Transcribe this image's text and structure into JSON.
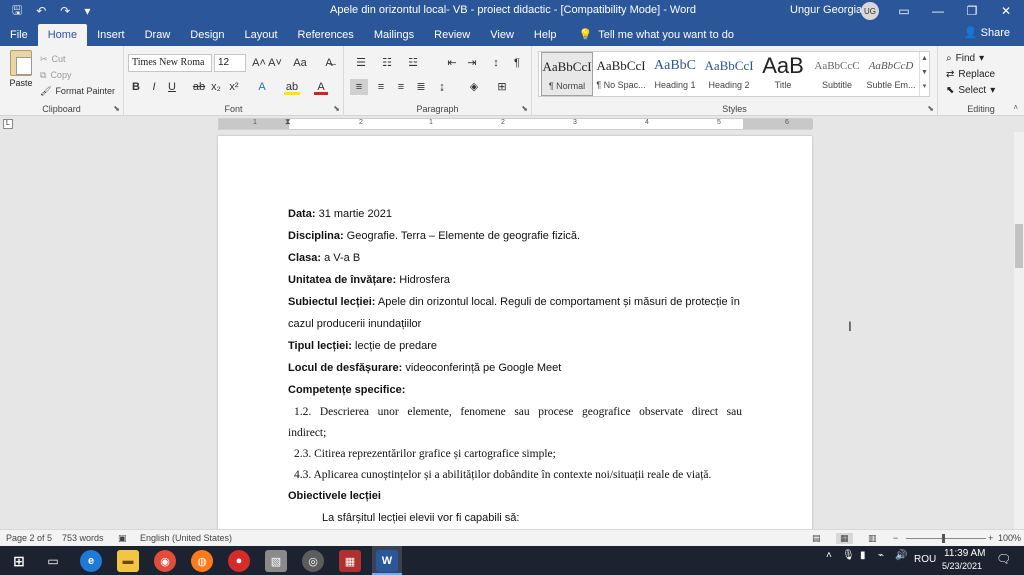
{
  "window": {
    "title": "Apele din orizontul local- VB - proiect didactic - [Compatibility Mode] - Word",
    "user": "Ungur Georgian",
    "user_initials": "UG"
  },
  "tabs": [
    "File",
    "Home",
    "Insert",
    "Draw",
    "Design",
    "Layout",
    "References",
    "Mailings",
    "Review",
    "View",
    "Help"
  ],
  "active_tab": "Home",
  "tell_me": "Tell me what you want to do",
  "share": "Share",
  "clipboard": {
    "paste": "Paste",
    "cut": "Cut",
    "copy": "Copy",
    "format_painter": "Format Painter",
    "label": "Clipboard"
  },
  "font": {
    "name": "Times New Roma",
    "size": "12",
    "label": "Font"
  },
  "paragraph": {
    "label": "Paragraph"
  },
  "styles": {
    "label": "Styles",
    "items": [
      {
        "preview": "AaBbCcI",
        "name": "¶ Normal"
      },
      {
        "preview": "AaBbCcI",
        "name": "¶ No Spac..."
      },
      {
        "preview": "AaBbC",
        "name": "Heading 1"
      },
      {
        "preview": "AaBbCcI",
        "name": "Heading 2"
      },
      {
        "preview": "AaB",
        "name": "Title"
      },
      {
        "preview": "AaBbCcC",
        "name": "Subtitle"
      },
      {
        "preview": "AaBbCcD",
        "name": "Subtle Em..."
      }
    ]
  },
  "editing": {
    "find": "Find",
    "replace": "Replace",
    "select": "Select",
    "label": "Editing"
  },
  "ruler_numbers": [
    "1",
    "2",
    "1",
    "2",
    "3",
    "4",
    "5",
    "6",
    "7"
  ],
  "document": {
    "lines": [
      {
        "label": "Data:",
        "text": " 31 martie 2021"
      },
      {
        "label": "Disciplina:",
        "text": " Geografie. Terra – Elemente de geografie fizică."
      },
      {
        "label": "Clasa:",
        "text": " a V-a B"
      },
      {
        "label": "Unitatea de învățare:",
        "text": " Hidrosfera"
      },
      {
        "label": "Subiectul lecției:",
        "text": " Apele din orizontul local. Reguli de comportament și măsuri de protecție în"
      },
      {
        "label": "",
        "text": "cazul producerii inundațiilor"
      },
      {
        "label": "Tipul lecției:",
        "text": " lecție de predare"
      },
      {
        "label": "Locul de desfășurare:",
        "text": " videoconferință pe Google Meet"
      },
      {
        "label": "Competențe specifice:",
        "text": ""
      },
      {
        "label": "",
        "text": "1.2. Descrierea unor elemente, fenomene sau procese geografice observate direct sau"
      },
      {
        "label": "",
        "text": "indirect;"
      },
      {
        "label": "",
        "text": "2.3. Citirea reprezentărilor grafice și cartografice simple;"
      },
      {
        "label": "",
        "text": "4.3. Aplicarea cunoștințelor și a abilităților dobândite în contexte noi/situații reale de viață."
      },
      {
        "label": "Obiectivele lecției",
        "text": ""
      },
      {
        "label": "",
        "text": "La sfârșitul lecției elevii vor fi capabili să:"
      }
    ]
  },
  "status": {
    "page": "Page 2 of 5",
    "words": "753 words",
    "language": "English (United States)",
    "zoom": "100%"
  },
  "taskbar": {
    "language": "ROU",
    "time": "11:39 AM",
    "date": "5/23/2021"
  }
}
